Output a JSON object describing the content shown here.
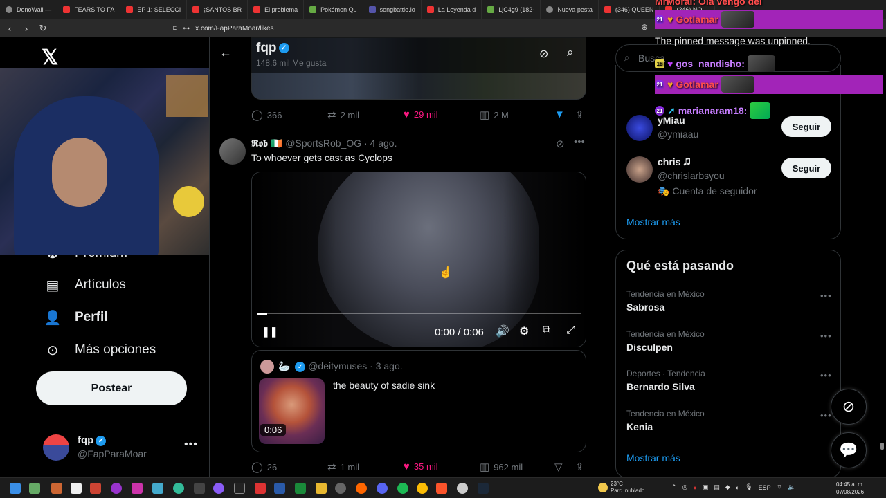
{
  "browser": {
    "tabs": [
      {
        "label": "DonoWall —",
        "icon": "globe-icon"
      },
      {
        "label": "FEARS TO FA",
        "icon": "youtube-icon"
      },
      {
        "label": "EP 1: SELECCI",
        "icon": "youtube-icon"
      },
      {
        "label": "¡SANTOS BR",
        "icon": "youtube-icon"
      },
      {
        "label": "El problema",
        "icon": "youtube-icon"
      },
      {
        "label": "Pokémon Qu",
        "icon": "pokemon-icon"
      },
      {
        "label": "songbattle.io",
        "icon": "songbattle-icon"
      },
      {
        "label": "La Leyenda d",
        "icon": "youtube-icon"
      },
      {
        "label": "LjC4g9 (182-",
        "icon": "app-icon"
      },
      {
        "label": "Nueva pesta",
        "icon": "shield-icon"
      },
      {
        "label": "(346) QUEEN",
        "icon": "youtube-icon"
      },
      {
        "label": "(346) NO",
        "icon": "youtube-icon"
      }
    ],
    "url": "x.com/FapParaMoar/likes"
  },
  "sidebar": {
    "items": [
      {
        "label": "Premium",
        "icon": "premium-icon"
      },
      {
        "label": "Artículos",
        "icon": "article-icon"
      },
      {
        "label": "Perfil",
        "icon": "profile-icon"
      },
      {
        "label": "Más opciones",
        "icon": "more-options-icon"
      }
    ],
    "post_button": "Postear",
    "account": {
      "name": "fqp",
      "handle": "@FapParaMoar"
    }
  },
  "header": {
    "name": "fqp",
    "subtitle": "148,6 mil Me gusta"
  },
  "tweet1": {
    "replies": "366",
    "reposts": "2 mil",
    "likes": "29 mil",
    "views": "2 M"
  },
  "tweet2": {
    "name": "𝕽𝖔𝖇",
    "flag": "🇮🇪",
    "handle": "@SportsRob_OG",
    "date": "· 4 ago.",
    "text": "To whoever gets cast as Cyclops",
    "video": {
      "time": "0:00 / 0:06",
      "progress": 0.03
    },
    "quote": {
      "emoji": "🦢",
      "handle": "@deitymuses",
      "date": "· 3 ago.",
      "text": "the beauty of sadie sink",
      "duration": "0:06"
    },
    "replies": "26",
    "reposts": "1 mil",
    "likes": "35 mil",
    "views": "962 mil"
  },
  "right": {
    "search_placeholder": "Busca",
    "who_to_follow": [
      {
        "name": "yMiau",
        "handle": "@ymiaau",
        "button": "Seguir",
        "sub": ""
      },
      {
        "name": "chris 🎜",
        "handle": "@chrislarbsyou",
        "button": "Seguir",
        "sub": "Cuenta de seguidor"
      }
    ],
    "show_more": "Mostrar más",
    "trends_title": "Qué está pasando",
    "trends": [
      {
        "context": "Tendencia en México",
        "title": "Sabrosa"
      },
      {
        "context": "Tendencia en México",
        "title": "Disculpen"
      },
      {
        "context": "Deportes · Tendencia",
        "title": "Bernardo Silva"
      },
      {
        "context": "Tendencia en México",
        "title": "Kenia"
      }
    ],
    "show_more_trends": "Mostrar más"
  },
  "chat": {
    "top_line": "MrMoral: Ola vengo del",
    "line1_user": "Gotlamar",
    "system": "The pinned message was unpinned.",
    "line3_user": "gos_nandisho:",
    "line4_user": "Gotlamar",
    "line5_user": "marianaram18:",
    "badges": {
      "b21": "21",
      "b18": "18"
    }
  },
  "taskbar": {
    "temp": "23°C",
    "weather": "Parc. nublado",
    "lang": "ESP",
    "time": "04:45 a. m.",
    "date": "07/08/2026"
  },
  "colors": {
    "accent": "#1d9bf0",
    "like": "#f91880",
    "chat_highlight": "#a224b8"
  }
}
